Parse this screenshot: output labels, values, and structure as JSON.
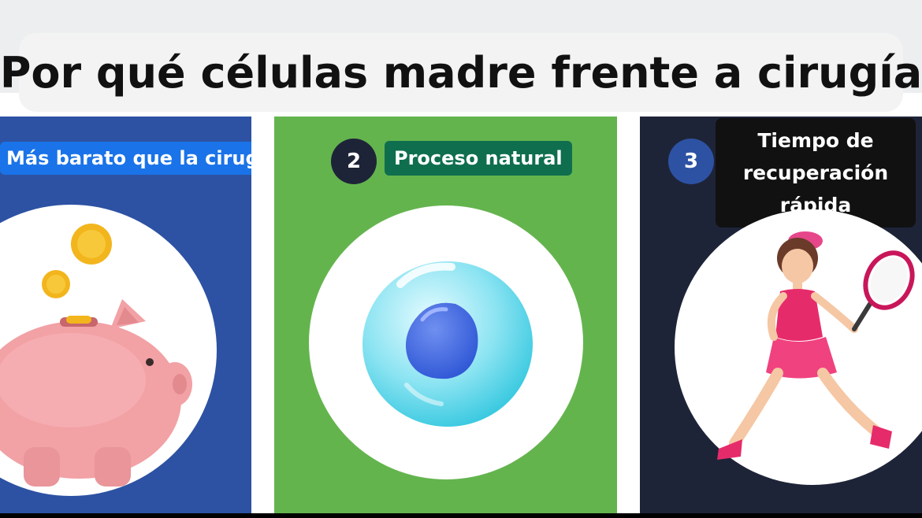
{
  "header": {
    "title": "Por qué células madre frente a cirugía"
  },
  "colors": {
    "panel1": "#2d52a3",
    "panel2": "#64b44e",
    "panel3": "#1e2438",
    "label1": "#1a73e8",
    "label2": "#0e6e4e",
    "label3": "#111111",
    "badge2": "#1e2438",
    "badge3": "#2d52a3"
  },
  "panels": [
    {
      "number": "",
      "label": "Más barato que la cirugía",
      "icon": "piggy-bank-icon"
    },
    {
      "number": "2",
      "label": "Proceso natural",
      "icon": "stem-cell-icon"
    },
    {
      "number": "3",
      "label": "Tiempo de recuperación rápida",
      "icon": "tennis-player-icon"
    }
  ]
}
